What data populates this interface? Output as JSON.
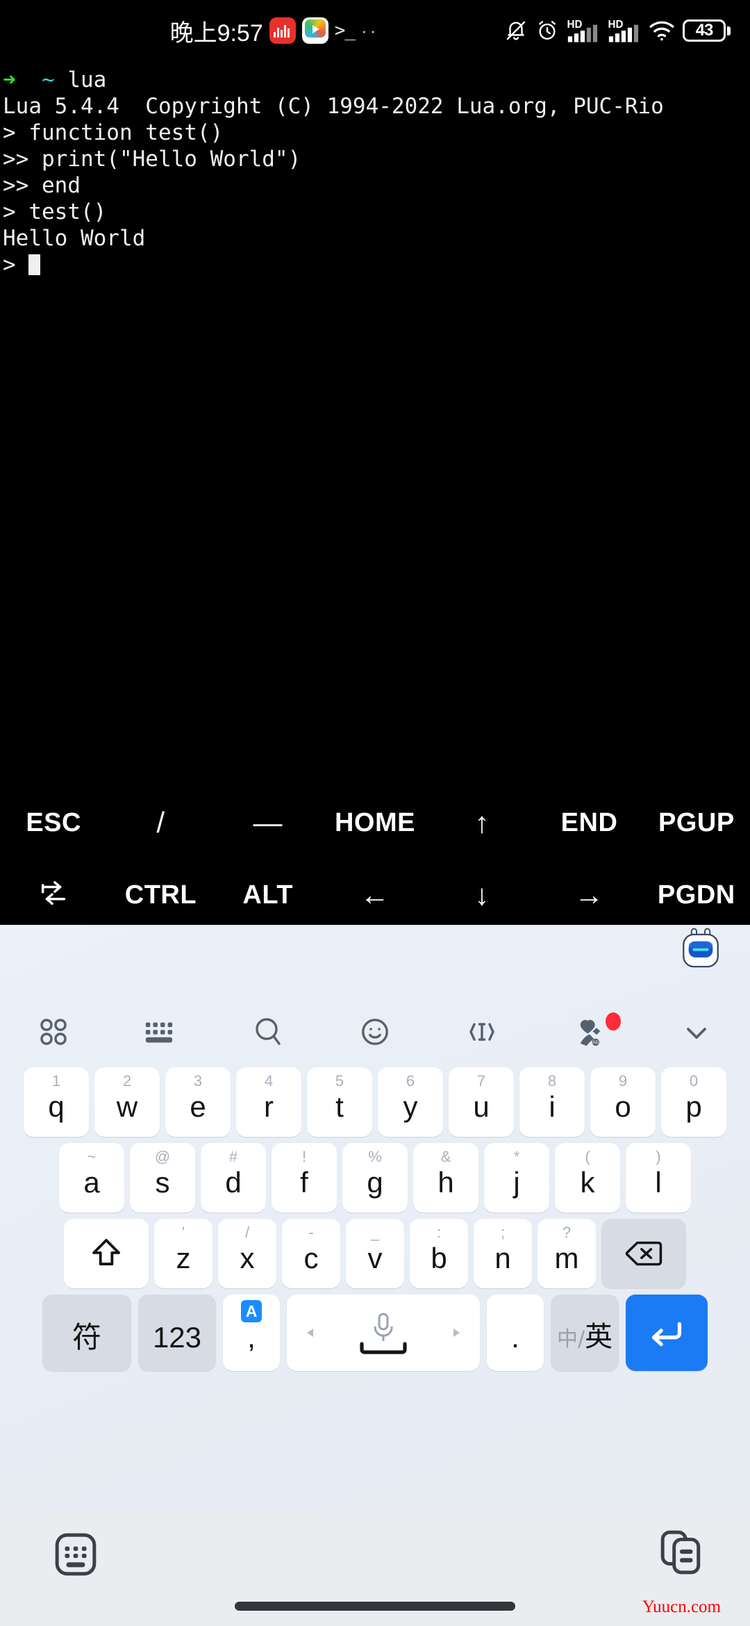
{
  "statusbar": {
    "clock": "晚上9:57",
    "app_icons": [
      {
        "name": "stock-app-icon"
      },
      {
        "name": "tencent-video-icon"
      }
    ],
    "terminal_glyph": ">_",
    "overflow_dots": "··",
    "icons": [
      {
        "name": "mute-bell-icon"
      },
      {
        "name": "alarm-clock-icon"
      },
      {
        "name": "hd-signal-sim1-icon",
        "label": "HD"
      },
      {
        "name": "hd-signal-sim2-icon",
        "label": "HD"
      },
      {
        "name": "wifi-icon"
      }
    ],
    "battery_level": "43"
  },
  "terminal": {
    "prompt_arrow": "➜",
    "prompt_dir": "~",
    "prompt_command": "lua",
    "lines": [
      "Lua 5.4.4  Copyright (C) 1994-2022 Lua.org, PUC-Rio",
      "> function test()",
      ">> print(\"Hello World\")",
      ">> end",
      "> test()",
      "Hello World"
    ],
    "last_prompt": "> "
  },
  "extra_keys": {
    "row1": [
      {
        "name": "esc-key",
        "label": "ESC"
      },
      {
        "name": "slash-key",
        "label": "/"
      },
      {
        "name": "dash-key",
        "label": "—"
      },
      {
        "name": "home-key",
        "label": "HOME"
      },
      {
        "name": "arrow-up-key",
        "label": "↑"
      },
      {
        "name": "end-key",
        "label": "END"
      },
      {
        "name": "pgup-key",
        "label": "PGUP"
      }
    ],
    "row2": [
      {
        "name": "tab-key",
        "label": ""
      },
      {
        "name": "ctrl-key",
        "label": "CTRL"
      },
      {
        "name": "alt-key",
        "label": "ALT"
      },
      {
        "name": "arrow-left-key",
        "label": "←"
      },
      {
        "name": "arrow-down-key",
        "label": "↓"
      },
      {
        "name": "arrow-right-key",
        "label": "→"
      },
      {
        "name": "pgdn-key",
        "label": "PGDN"
      }
    ]
  },
  "keyboard": {
    "toolbar": [
      {
        "name": "grid-apps-icon"
      },
      {
        "name": "keyboard-layout-icon"
      },
      {
        "name": "search-icon"
      },
      {
        "name": "emoji-icon"
      },
      {
        "name": "cursor-move-icon"
      },
      {
        "name": "sticker-ad-icon",
        "badge": true
      },
      {
        "name": "collapse-chevron-icon"
      }
    ],
    "mascot": {
      "name": "assistant-mascot-icon"
    },
    "row1": [
      {
        "main": "q",
        "hint": "1"
      },
      {
        "main": "w",
        "hint": "2"
      },
      {
        "main": "e",
        "hint": "3"
      },
      {
        "main": "r",
        "hint": "4"
      },
      {
        "main": "t",
        "hint": "5"
      },
      {
        "main": "y",
        "hint": "6"
      },
      {
        "main": "u",
        "hint": "7"
      },
      {
        "main": "i",
        "hint": "8"
      },
      {
        "main": "o",
        "hint": "9"
      },
      {
        "main": "p",
        "hint": "0"
      }
    ],
    "row2": [
      {
        "main": "a",
        "hint": "~"
      },
      {
        "main": "s",
        "hint": "@"
      },
      {
        "main": "d",
        "hint": "#"
      },
      {
        "main": "f",
        "hint": "!"
      },
      {
        "main": "g",
        "hint": "%"
      },
      {
        "main": "h",
        "hint": "&"
      },
      {
        "main": "j",
        "hint": "*"
      },
      {
        "main": "k",
        "hint": "("
      },
      {
        "main": "l",
        "hint": ")"
      }
    ],
    "row3": [
      {
        "main": "z",
        "hint": "'"
      },
      {
        "main": "x",
        "hint": "/"
      },
      {
        "main": "c",
        "hint": "-"
      },
      {
        "main": "v",
        "hint": "_"
      },
      {
        "main": "b",
        "hint": ":"
      },
      {
        "main": "n",
        "hint": ";"
      },
      {
        "main": "m",
        "hint": "?"
      }
    ],
    "shift_key": {
      "name": "shift-key"
    },
    "backspace_key": {
      "name": "backspace-key"
    },
    "row4": {
      "symbols_label": "符",
      "numbers_label": "123",
      "comma_label": ",",
      "comma_badge": "A",
      "period_label": ".",
      "lang_zh": "中",
      "lang_sep": "/",
      "lang_en": "英"
    }
  },
  "navbar": {
    "hide_keyboard": {
      "name": "hide-keyboard-icon"
    },
    "clipboard": {
      "name": "clipboard-icon"
    },
    "watermark": "Yuucn.com",
    "home_indicator": {
      "name": "home-indicator"
    }
  },
  "colors": {
    "accent_blue": "#1a7bf5",
    "badge_red": "#ff2b36",
    "terminal_green": "#2ee12e",
    "terminal_cyan": "#2ad4e0",
    "keyboard_bg": "#e9eef6",
    "key_gray": "#d7dce4"
  }
}
